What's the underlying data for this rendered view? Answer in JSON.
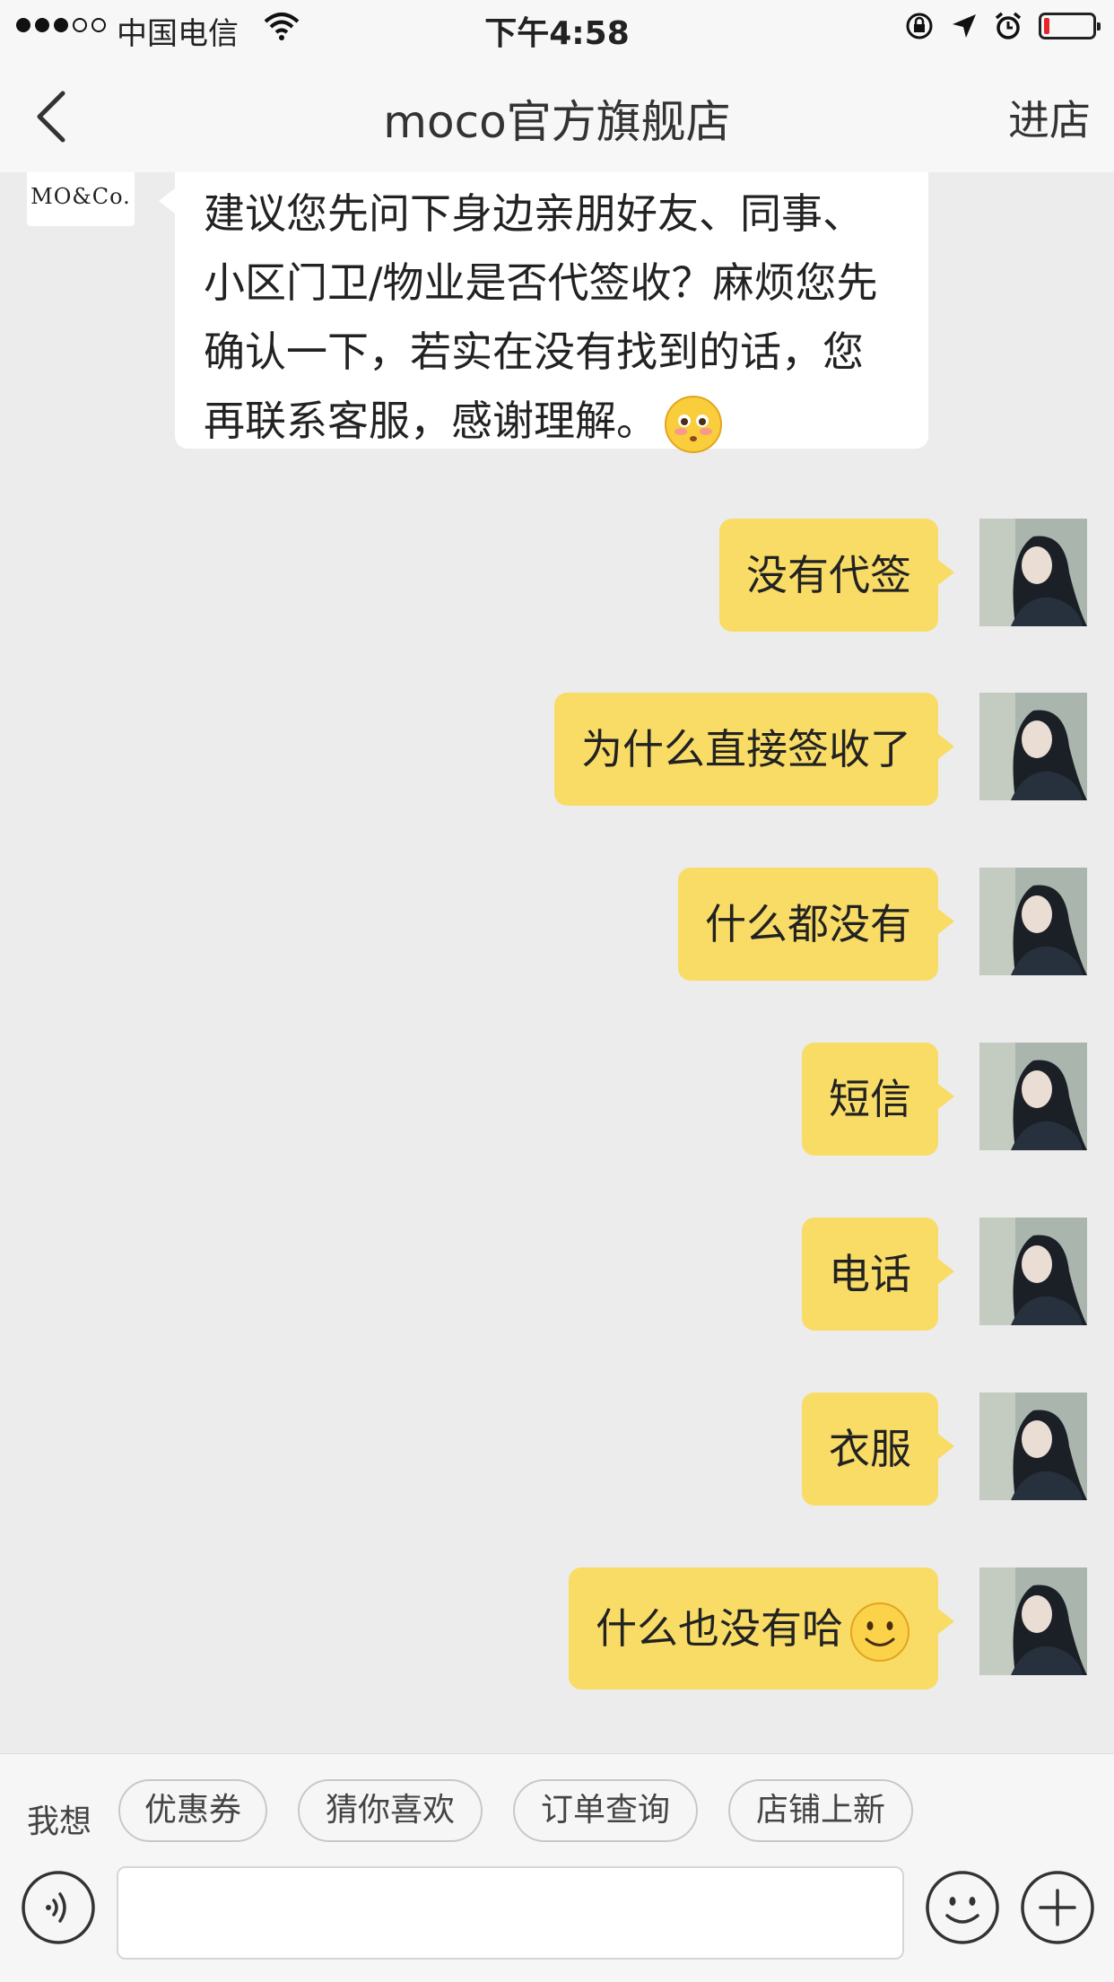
{
  "status_bar": {
    "carrier": "中国电信",
    "time": "下午4:58",
    "battery_level": 0.12
  },
  "nav": {
    "title": "moco官方旗舰店",
    "action_label": "进店"
  },
  "store": {
    "logo_text": "MO&Co."
  },
  "messages": {
    "incoming": [
      {
        "line1": "建议您先问下身边亲朋好友、同事、",
        "line2": "小区门卫/物业是否代签收？麻烦您先",
        "line3": "确认一下，若实在没有找到的话，您",
        "line4": "再联系客服，感谢理解。",
        "emoji": "blush-face-icon"
      }
    ],
    "outgoing": [
      {
        "text": "没有代签"
      },
      {
        "text": "为什么直接签收了"
      },
      {
        "text": "什么都没有"
      },
      {
        "text": "短信"
      },
      {
        "text": "电话"
      },
      {
        "text": "衣服"
      },
      {
        "text": "什么也没有哈",
        "emoji": "smile-face-icon"
      }
    ]
  },
  "quick_replies": {
    "label": "我想",
    "items": [
      "优惠券",
      "猜你喜欢",
      "订单查询",
      "店铺上新"
    ]
  },
  "input": {
    "value": "",
    "placeholder": ""
  },
  "colors": {
    "outgoing_bubble": "#f8dc66",
    "incoming_bubble": "#ffffff",
    "chat_background": "#ececec",
    "battery_low": "#e8242b"
  }
}
